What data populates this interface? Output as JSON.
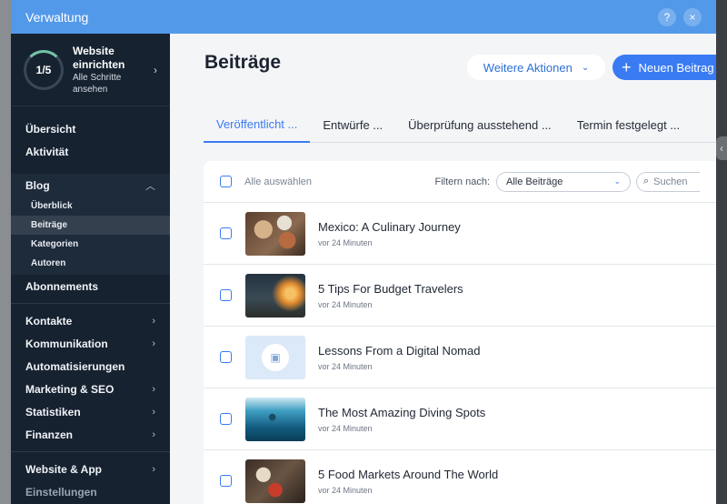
{
  "window": {
    "title": "Verwaltung",
    "help_icon": "?",
    "close_icon": "×"
  },
  "setup": {
    "progress": "1/5",
    "title": "Website einrichten",
    "subtitle": "Alle Schritte ansehen"
  },
  "sidebar": {
    "items_top": [
      {
        "label": "Übersicht"
      },
      {
        "label": "Aktivität"
      }
    ],
    "blog": {
      "label": "Blog",
      "sub": [
        {
          "label": "Überblick"
        },
        {
          "label": "Beiträge"
        },
        {
          "label": "Kategorien"
        },
        {
          "label": "Autoren"
        }
      ]
    },
    "abonnements": "Abonnements",
    "items_mid": [
      {
        "label": "Kontakte"
      },
      {
        "label": "Kommunikation"
      },
      {
        "label": "Automatisierungen"
      },
      {
        "label": "Marketing & SEO"
      },
      {
        "label": "Statistiken"
      },
      {
        "label": "Finanzen"
      }
    ],
    "items_bottom": [
      {
        "label": "Website & App"
      },
      {
        "label": "Einstellungen"
      }
    ]
  },
  "main": {
    "title": "Beiträge",
    "more_actions": "Weitere Aktionen",
    "new_post": "Neuen Beitrag",
    "tabs": [
      {
        "label": "Veröffentlicht ..."
      },
      {
        "label": "Entwürfe ..."
      },
      {
        "label": "Überprüfung ausstehend ..."
      },
      {
        "label": "Termin festgelegt ..."
      }
    ],
    "select_all": "Alle auswählen",
    "filter_label": "Filtern nach:",
    "filter_value": "Alle Beiträge",
    "search_placeholder": "Suchen",
    "posts": [
      {
        "title": "Mexico: A Culinary Journey",
        "meta": "vor 24 Minuten"
      },
      {
        "title": "5 Tips For Budget Travelers",
        "meta": "vor 24 Minuten"
      },
      {
        "title": "Lessons From a Digital Nomad",
        "meta": "vor 24 Minuten"
      },
      {
        "title": "The Most Amazing Diving Spots",
        "meta": "vor 24 Minuten"
      },
      {
        "title": "5 Food Markets Around The World",
        "meta": "vor 24 Minuten"
      }
    ]
  },
  "colors": {
    "topbar": "#5399ea",
    "sidebar": "#172230",
    "accent": "#3a7bf3"
  }
}
